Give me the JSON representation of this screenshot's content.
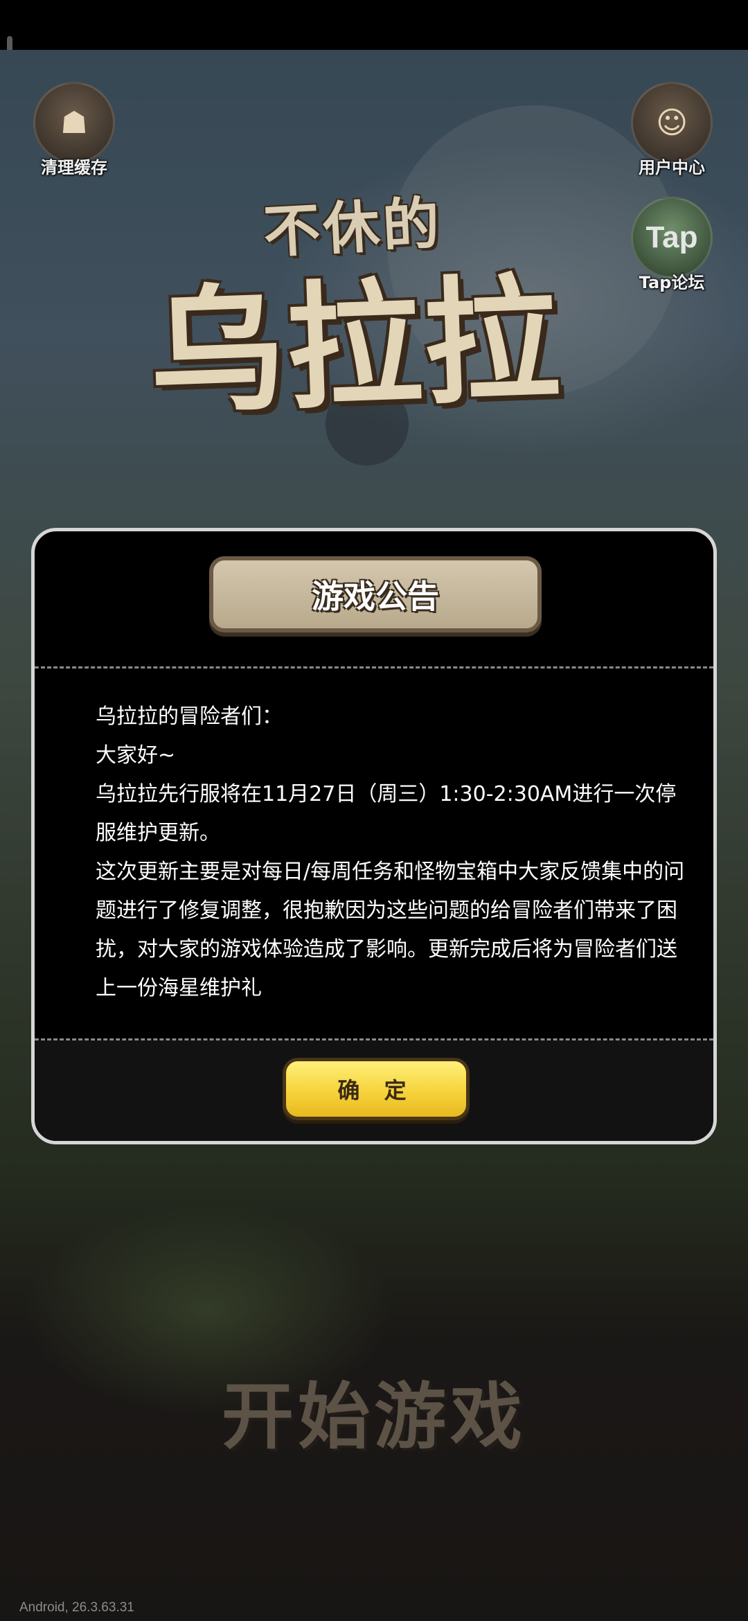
{
  "header": {
    "clear_cache_label": "清理缓存",
    "user_center_label": "用户中心",
    "tap_forum_label": "Tap论坛",
    "tap_logo_text": "Tap"
  },
  "logo": {
    "line1": "不休的",
    "line2": "乌拉拉"
  },
  "announcement": {
    "title": "游戏公告",
    "paragraphs": [
      "乌拉拉的冒险者们：",
      "大家好~",
      "乌拉拉先行服将在11月27日（周三）1:30-2:30AM进行一次停服维护更新。",
      "这次更新主要是对每日/每周任务和怪物宝箱中大家反馈集中的问题进行了修复调整，很抱歉因为这些问题的给冒险者们带来了困扰，对大家的游戏体验造成了影响。更新完成后将为冒险者们送上一份海星维护礼"
    ],
    "confirm_label": "确 定"
  },
  "start_game_label": "开始游戏",
  "version_text": "Android, 26.3.63.31"
}
